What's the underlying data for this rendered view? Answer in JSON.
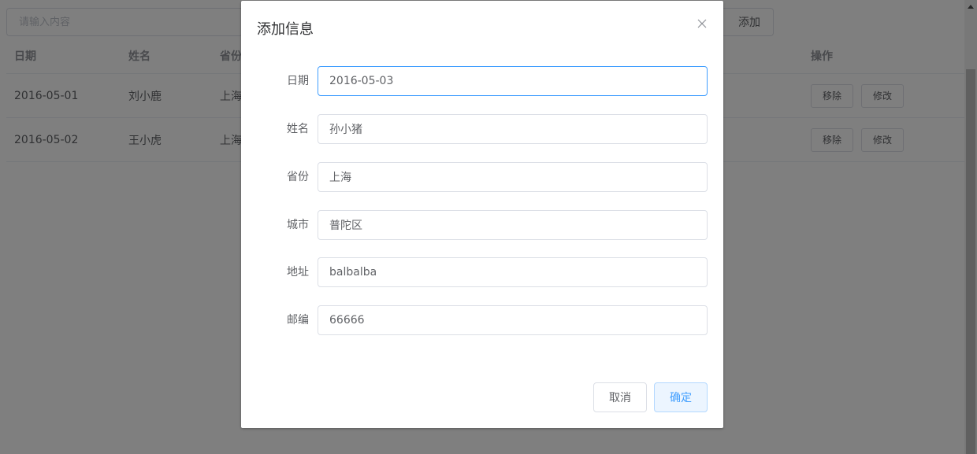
{
  "toolbar": {
    "search_placeholder": "请输入内容",
    "add_label": "添加"
  },
  "table": {
    "headers": {
      "date": "日期",
      "name": "姓名",
      "province": "省份",
      "ops": "操作"
    },
    "rows": [
      {
        "date": "2016-05-01",
        "name": "刘小鹿",
        "province": "上海",
        "remove": "移除",
        "edit": "修改"
      },
      {
        "date": "2016-05-02",
        "name": "王小虎",
        "province": "上海",
        "remove": "移除",
        "edit": "修改"
      }
    ]
  },
  "dialog": {
    "title": "添加信息",
    "fields": [
      {
        "label": "日期",
        "value": "2016-05-03"
      },
      {
        "label": "姓名",
        "value": "孙小猪"
      },
      {
        "label": "省份",
        "value": "上海"
      },
      {
        "label": "城市",
        "value": "普陀区"
      },
      {
        "label": "地址",
        "value": "balbalba"
      },
      {
        "label": "邮编",
        "value": "66666"
      }
    ],
    "cancel_label": "取消",
    "confirm_label": "确定"
  },
  "colors": {
    "primary": "#409eff",
    "overlay": "rgba(0,0,0,0.5)",
    "border": "#dcdfe6"
  }
}
